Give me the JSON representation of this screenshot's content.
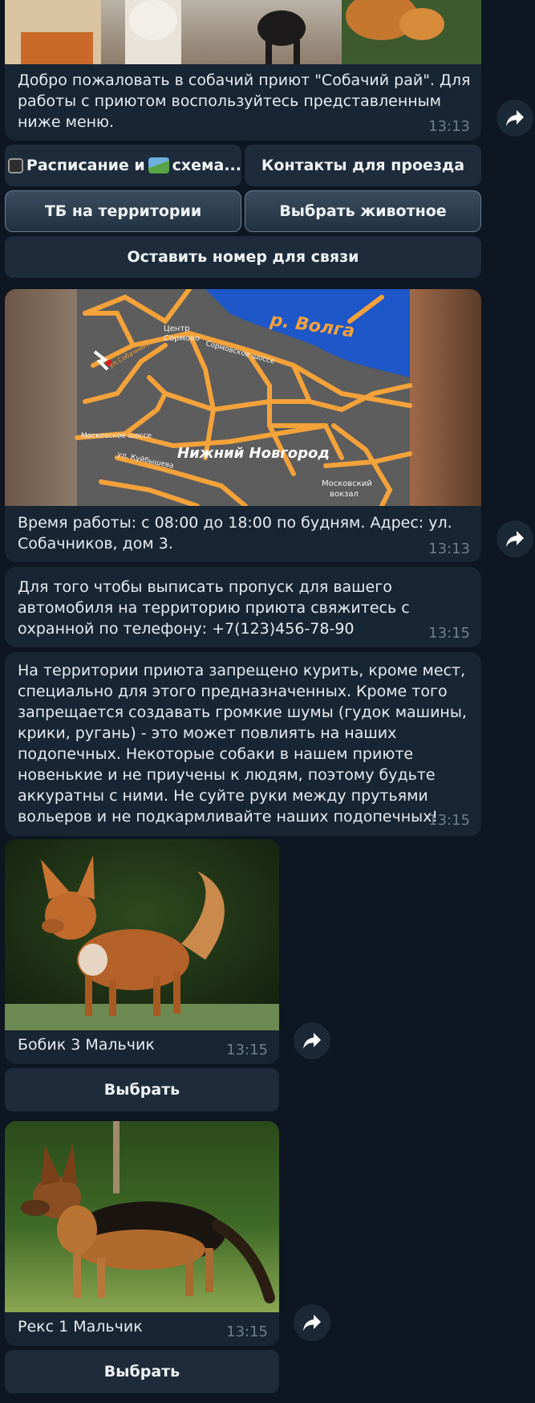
{
  "welcome": {
    "text": "Добро пожаловать в собачий приют \"Собачий рай\". Для работы с приютом воспользуйтесь представленным ниже меню.",
    "time": "13:13"
  },
  "keyboard": {
    "schedule_label": "Расписание и",
    "schedule_suffix": "схема...",
    "contacts_label": "Контакты для проезда",
    "safety_label": "ТБ на территории",
    "choose_animal_label": "Выбрать животное",
    "leave_phone_label": "Оставить номер для связи"
  },
  "map_message": {
    "map_labels": {
      "river": "р. Волга",
      "center": "Центр",
      "sormovo": "Сормово",
      "sormovo_highway": "Сормовское шоссе",
      "moscow_highway": "Московское шоссе",
      "city": "Нижний Новгород",
      "station_line1": "Московский",
      "station_line2": "вокзал",
      "street_kuybysheva": "ул. Куйбышева",
      "street_sobachnikov": "ул.Собачников"
    },
    "text": "Время работы: с 08:00 до 18:00 по будням. Адрес: ул. Собачников, дом 3.",
    "time": "13:13"
  },
  "pass_message": {
    "text": "Для того чтобы выписать пропуск для вашего автомобиля на территорию приюта свяжитесь с охранной по телефону: +7(123)456-78-90",
    "time": "13:15"
  },
  "rules_message": {
    "text": "На территории приюта запрещено курить, кроме мест, специально для этого предназначенных. Кроме того запрещается создавать громкие шумы (гудок машины, крики, ругань) - это может повлиять на наших подопечных. Некоторые собаки в нашем приюте новенькие и не приучены к людям, поэтому будьте аккуратны с ними. Не суйте руки между прутьями вольеров и не подкармливайте наших подопечных!",
    "time": "13:15"
  },
  "pets": [
    {
      "caption": "Бобик 3 Мальчик",
      "time": "13:15",
      "button": "Выбрать"
    },
    {
      "caption": "Рекс 1 Мальчик",
      "time": "13:15",
      "button": "Выбрать"
    }
  ],
  "icons": {
    "forward": "forward-arrow-icon",
    "clock": "watch-emoji-icon",
    "map": "map-emoji-icon"
  },
  "colors": {
    "background": "#0e1621",
    "bubble": "#182533",
    "button": "#1d2b3a",
    "time": "#6d7f8f",
    "map_roads": "#f4a23a",
    "map_water": "#1e57c8"
  }
}
